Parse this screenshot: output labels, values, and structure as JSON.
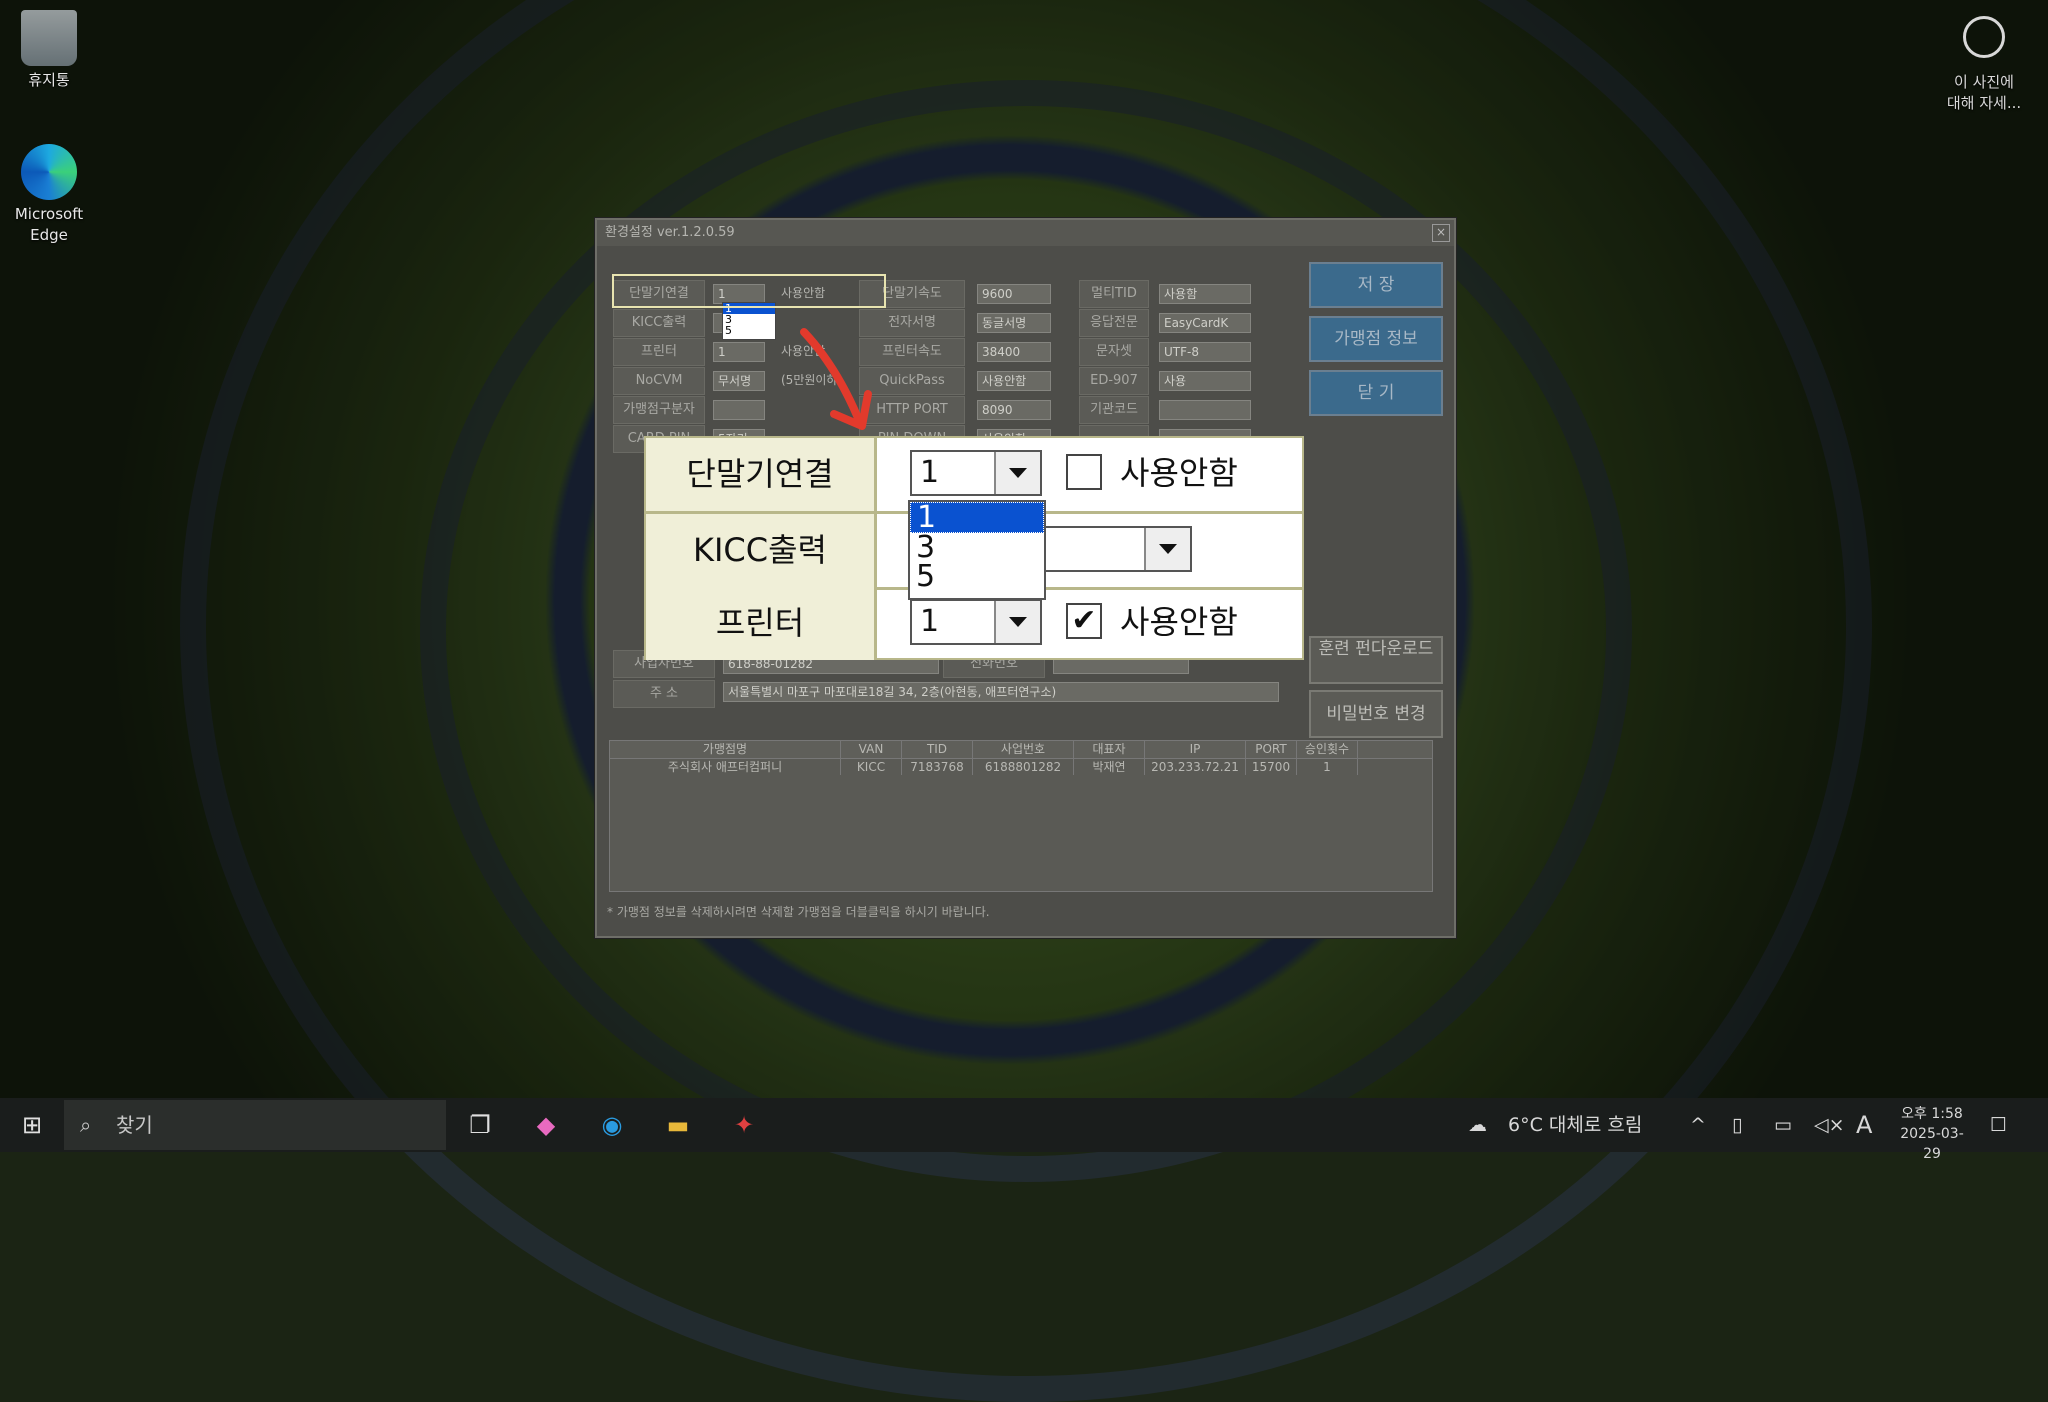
{
  "desktop": {
    "icons": [
      {
        "label": "휴지통"
      },
      {
        "label": "Microsoft\nEdge"
      }
    ],
    "photo_info": "이 사진에\n대해 자세..."
  },
  "dialog": {
    "title": "환경설정 ver.1.2.0.59",
    "close": "×",
    "rows": [
      {
        "l1": "단말기연결",
        "v1": "1",
        "chk1": "사용안함",
        "l2": "단말기속도",
        "v2": "9600",
        "l3": "멀티TID",
        "v3": "사용함"
      },
      {
        "l1": "KICC출력",
        "v1": "",
        "chk1": "",
        "l2": "전자서명",
        "v2": "동글서명",
        "l3": "응답전문",
        "v3": "EasyCardK"
      },
      {
        "l1": "프린터",
        "v1": "1",
        "chk1": "사용안함",
        "l2": "프린터속도",
        "v2": "38400",
        "l3": "문자셋",
        "v3": "UTF-8"
      },
      {
        "l1": "NoCVM",
        "v1": "무서명",
        "chk1": "(5만원이하)",
        "l2": "QuickPass",
        "v2": "사용안함",
        "l3": "ED-907",
        "v3": "사용"
      },
      {
        "l1": "가맹점구분자",
        "v1": "",
        "chk1": "",
        "l2": "HTTP PORT",
        "v2": "8090",
        "l3": "기관코드",
        "v3": ""
      },
      {
        "l1": "CARD PIN",
        "v1": "5자리",
        "chk1": "",
        "l2": "PIN DOWN",
        "v2": "사용안함",
        "l3": "",
        "v3": ""
      }
    ],
    "dropdown_options": [
      "1",
      "3",
      "5"
    ],
    "buttons": {
      "save": "저 장",
      "store_info": "가맹점 정보",
      "close": "닫 기",
      "training": "훈련 펀다운로드",
      "password": "비밀번호 변경"
    },
    "biz": {
      "biz_no_label": "사업자번호",
      "biz_no": "618-88-01282",
      "phone_label": "전화번호",
      "addr_label": "주 소",
      "addr": "서울특별시 마포구 마포대로18길 34, 2층(아현동, 애프터연구소)"
    },
    "table": {
      "headers": [
        "가맹점명",
        "VAN",
        "TID",
        "사업번호",
        "대표자",
        "IP",
        "PORT",
        "승인횟수"
      ],
      "rows": [
        [
          "주식회사 애프터컴퍼니",
          "KICC",
          "7183768",
          "6188801282",
          "박재연",
          "203.233.72.21",
          "15700",
          "1"
        ]
      ]
    },
    "footer": "* 가맹점 정보를 삭제하시려면 삭제할 가맹점을 더블클릭을 하시기 바랍니다."
  },
  "zoom": {
    "row1_label": "단말기연결",
    "row1_value": "1",
    "row1_check": "사용안함",
    "row2_label": "KICC출력",
    "row3_label": "프린터",
    "row3_value": "1",
    "row3_check": "사용안함",
    "row3_checked": "✔",
    "options": [
      "1",
      "3",
      "5"
    ]
  },
  "taskbar": {
    "search_placeholder": "찾기",
    "weather": "6°C  대체로 흐림",
    "ime": "A",
    "time": "오후 1:58",
    "date": "2025-03-29"
  },
  "colors": {
    "arrow": "#e23a2c",
    "highlight": "#0a52d0"
  }
}
